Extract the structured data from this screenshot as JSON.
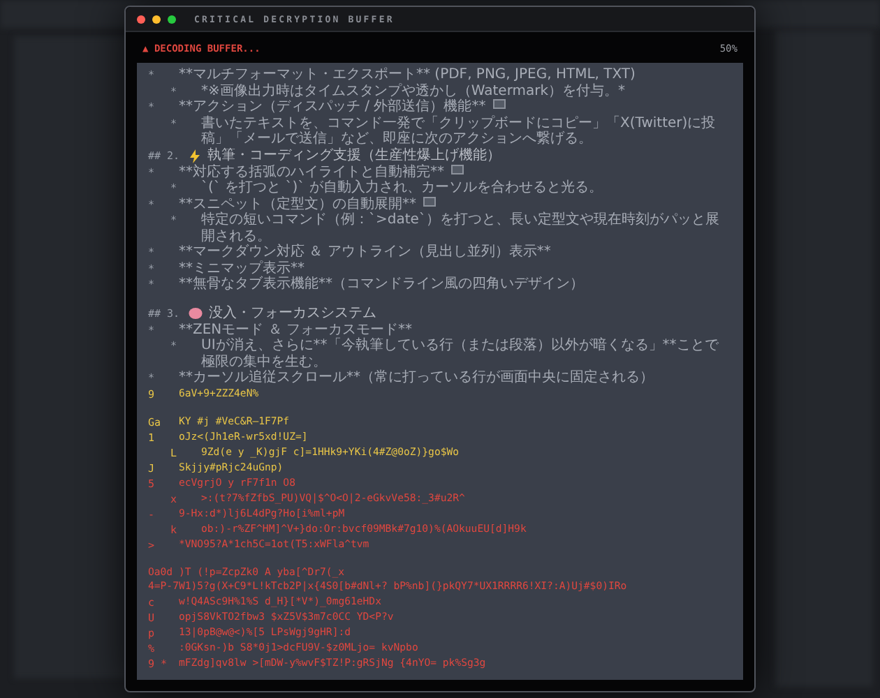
{
  "window": {
    "title": "CRITICAL DECRYPTION BUFFER"
  },
  "status": {
    "icon": "▲",
    "text": "DECODING BUFFER...",
    "percent": "50%"
  },
  "lines": [
    {
      "kind": "bullet",
      "marker": "*",
      "text": "**マルチフォーマット・エクスポート** (PDF, PNG, JPEG, HTML, TXT)",
      "new": false,
      "children": [
        {
          "kind": "bullet",
          "marker": "*",
          "text": "*※画像出力時はタイムスタンプや透かし（Watermark）を付与。*",
          "new": false
        }
      ]
    },
    {
      "kind": "bullet",
      "marker": "*",
      "text": "**アクション（ディスパッチ / 外部送信）機能**",
      "new": true,
      "children": [
        {
          "kind": "bullet",
          "marker": "*",
          "text": "書いたテキストを、コマンド一発で「クリップボードにコピー」「X(Twitter)に投稿」「メールで送信」など、即座に次のアクションへ繋げる。",
          "new": false
        }
      ]
    },
    {
      "kind": "heading",
      "prefix": "## 2.",
      "text": "執筆・コーディング支援（生産性爆上げ機能）"
    },
    {
      "kind": "bullet",
      "marker": "*",
      "text": "**対応する括弧のハイライトと自動補完**",
      "new": true,
      "children": [
        {
          "kind": "bullet",
          "marker": "*",
          "text": "`(` を打つと `)` が自動入力され、カーソルを合わせると光る。",
          "new": false
        }
      ]
    },
    {
      "kind": "bullet",
      "marker": "*",
      "text": "**スニペット（定型文）の自動展開**",
      "new": true,
      "children": [
        {
          "kind": "bullet",
          "marker": "*",
          "text": "特定の短いコマンド（例：`>date`）を打つと、長い定型文や現在時刻がパッと展開される。",
          "new": false
        }
      ]
    },
    {
      "kind": "bullet",
      "marker": "*",
      "text": "**マークダウン対応 ＆ アウトライン（見出し並列）表示**",
      "new": false
    },
    {
      "kind": "bullet",
      "marker": "*",
      "text": "**ミニマップ表示**",
      "new": false
    },
    {
      "kind": "bullet",
      "marker": "*",
      "text": "**無骨なタブ表示機能**（コマンドライン風の四角いデザイン）",
      "new": false
    },
    {
      "kind": "blank"
    },
    {
      "kind": "heading",
      "prefix": "## 3.",
      "text": "没入・フォーカスシステム"
    },
    {
      "kind": "bullet",
      "marker": "*",
      "text": "**ZENモード ＆ フォーカスモード**",
      "new": false,
      "children": [
        {
          "kind": "bullet",
          "marker": "*",
          "text": "UIが消え、さらに**「今執筆している行（または段落）以外が暗くなる」**ことで極限の集中を生む。",
          "new": false
        }
      ]
    },
    {
      "kind": "bullet",
      "marker": "*",
      "text": "**カーソル追従スクロール**（常に打っている行が画面中央に固定される）",
      "new": false
    },
    {
      "kind": "glitch",
      "color": "#e8c547",
      "marker": "9",
      "text": "6aV+9+ZZZ4eN%"
    },
    {
      "kind": "blank"
    },
    {
      "kind": "glitch",
      "color": "#e8c547",
      "marker": "Ga",
      "text": "KY #j #VeC&R—1F7Pf"
    },
    {
      "kind": "glitch",
      "color": "#e8c547",
      "marker": "1",
      "text": "oJz<(Jh1eR-wr5xd!UZ=]",
      "children": [
        {
          "kind": "glitch",
          "color": "#e8c547",
          "marker": "L",
          "text": "9Zd(e y _K)gjF c]=1HHk9+YKi(4#Z@0oZ)}go$Wo"
        }
      ]
    },
    {
      "kind": "glitch",
      "color": "#e8c547",
      "marker": "J",
      "text": "Skjjy#pRjc24uGnp)"
    },
    {
      "kind": "glitch",
      "color": "#e0473f",
      "marker": "5",
      "text": "ecVgrjO y rF7f1n O8",
      "children": [
        {
          "kind": "glitch",
          "color": "#e0473f",
          "marker": "x",
          "text": ">:(t?7%fZfbS_PU)VQ|$^O<O|2-eGkvVe58:_3#u2R^"
        }
      ]
    },
    {
      "kind": "glitch",
      "color": "#e0473f",
      "marker": "-",
      "text": "9-Hx:d*)lj6L4dPg?Ho[i%ml+pM",
      "children": [
        {
          "kind": "glitch",
          "color": "#e0473f",
          "marker": "k",
          "text": "ob:)-r%ZF^HM]^V+}do:Or:bvcf09MBk#7g10)%(AOkuuEU[d]H9k"
        }
      ]
    },
    {
      "kind": "glitch",
      "color": "#e0473f",
      "marker": ">",
      "text": "*VNO95?A*1ch5C=1ot(T5:xWFla^tvm"
    },
    {
      "kind": "blank"
    },
    {
      "kind": "glitch",
      "color": "#e0473f",
      "text": "Oa0d )T (!p=ZcpZk0 A yba[^Dr7(_x"
    },
    {
      "kind": "glitch",
      "color": "#e0473f",
      "text": "4=P-7W1)5?g(X+C9*L!kTcb2P|x{4S0[b#dNl+? bP%nb](}pkQY7*UX1RRRR6!XI?:A)Uj#$0)IRo"
    },
    {
      "kind": "glitch",
      "color": "#e0473f",
      "marker": "c",
      "text": "w!Q4ASc9H%1%S d_H}[*V*)_0mg61eHDx"
    },
    {
      "kind": "glitch",
      "color": "#e0473f",
      "marker": "U",
      "text": "opjS8VkTO2fbw3 $xZ5V$3m7c0CC YD<P?v"
    },
    {
      "kind": "glitch",
      "color": "#e0473f",
      "marker": "p",
      "text": "13|0pB@w@<)%[5 LPsWgj9gHR]:d"
    },
    {
      "kind": "glitch",
      "color": "#e0473f",
      "marker": "%",
      "text": ":0GKsn-)b S8*0j1>dcFU9V-$z0MLjo= kvNpbo"
    },
    {
      "kind": "glitch",
      "color": "#e0473f",
      "marker": "9 *",
      "text": "mFZdg]qv8lw >[mDW-y%wvF$TZ!P:gRSjNg {4nYO= pk%Sg3g"
    }
  ]
}
